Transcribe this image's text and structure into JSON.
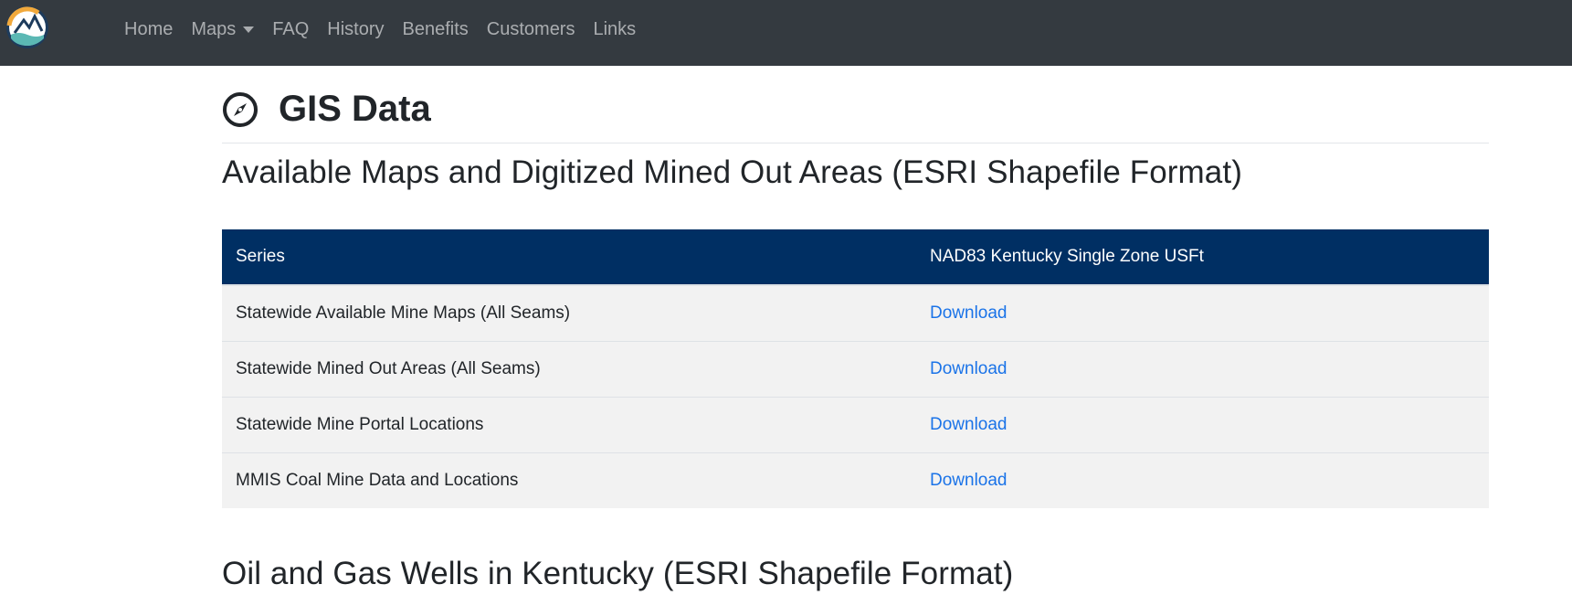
{
  "nav": {
    "logo_icon": "mountain-wave-logo-icon",
    "items": [
      {
        "label": "Home"
      },
      {
        "label": "Maps",
        "dropdown": true
      },
      {
        "label": "FAQ"
      },
      {
        "label": "History"
      },
      {
        "label": "Benefits"
      },
      {
        "label": "Customers"
      },
      {
        "label": "Links"
      }
    ]
  },
  "page": {
    "title_icon": "compass-icon",
    "title": "GIS Data",
    "section1_title": "Available Maps and Digitized Mined Out Areas (ESRI Shapefile Format)",
    "section2_title": "Oil and Gas Wells in Kentucky (ESRI Shapefile Format)"
  },
  "table": {
    "headers": [
      "Series",
      "NAD83 Kentucky Single Zone USFt"
    ],
    "rows": [
      {
        "series": "Statewide Available Mine Maps (All Seams)",
        "link": "Download"
      },
      {
        "series": "Statewide Mined Out Areas (All Seams)",
        "link": "Download"
      },
      {
        "series": "Statewide Mine Portal Locations",
        "link": "Download"
      },
      {
        "series": "MMIS Coal Mine Data and Locations",
        "link": "Download"
      }
    ]
  },
  "colors": {
    "navbar_bg": "#343a40",
    "table_header_bg": "#002f63",
    "link": "#1a73e8",
    "row_bg": "#f2f2f2"
  }
}
